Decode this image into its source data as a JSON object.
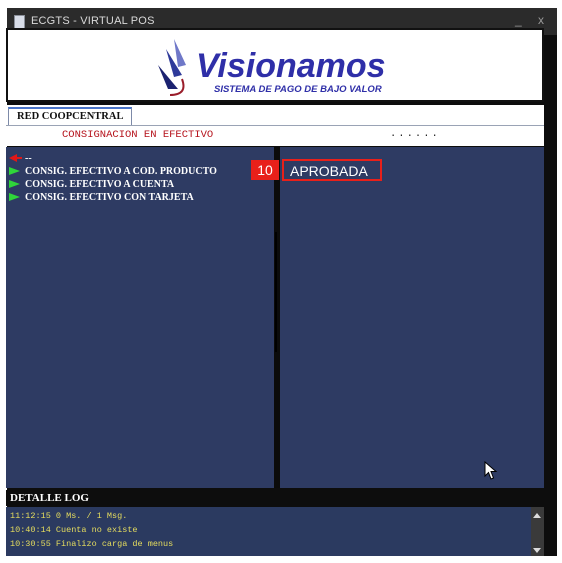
{
  "window": {
    "title": "ECGTS - VIRTUAL POS",
    "minimize": "_",
    "close": "x"
  },
  "banner": {
    "brand": "Visionamos",
    "tagline": "SISTEMA DE PAGO DE BAJO VALOR"
  },
  "tab": {
    "label": "RED COOPCENTRAL"
  },
  "subheader": {
    "section": "CONSIGNACION EN EFECTIVO",
    "dots": "......"
  },
  "menu": {
    "back_label": "--",
    "items": [
      "CONSIG. EFECTIVO A COD. PRODUCTO",
      "CONSIG. EFECTIVO A CUENTA",
      "CONSIG. EFECTIVO CON TARJETA"
    ]
  },
  "annotation": {
    "badge": "10",
    "status": "APROBADA"
  },
  "log": {
    "header": "DETALLE LOG",
    "lines": [
      "11:12:15 0 Ms. / 1 Msg.",
      "10:40:14 Cuenta no existe",
      "10:30:55 Finalizo carga de menus"
    ]
  },
  "colors": {
    "panel": "#2e3b63",
    "accent": "#e8201a",
    "log_text": "#e6dd5e",
    "menu_arrow": "#2fd53a"
  }
}
